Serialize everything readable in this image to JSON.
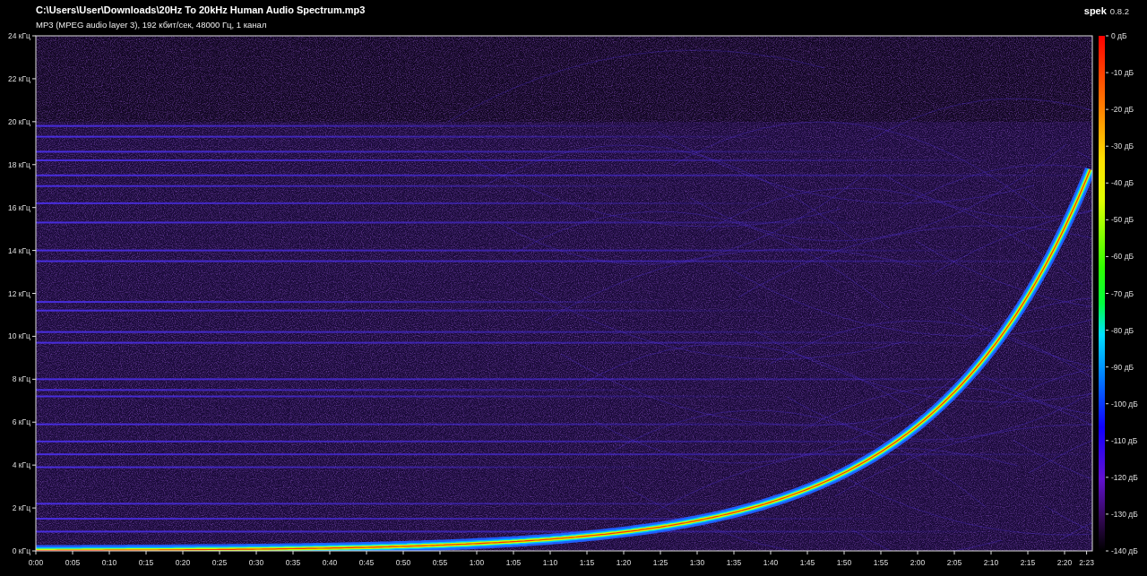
{
  "header": {
    "title": "C:\\Users\\User\\Downloads\\20Hz To 20kHz Human Audio Spectrum.mp3",
    "format_info": "MP3 (MPEG audio layer 3), 192 кбит/сек, 48000 Гц, 1 канал",
    "app_name": "spek",
    "app_version": "0.8.2"
  },
  "spectrogram": {
    "y_axis": [
      "24 кГц",
      "22 кГц",
      "20 кГц",
      "18 кГц",
      "16 кГц",
      "14 кГц",
      "12 кГц",
      "10 кГц",
      "8 кГц",
      "6 кГц",
      "4 кГц",
      "2 кГц",
      "0 кГц"
    ],
    "x_axis": {
      "ticks": [
        "0:00",
        "0:05",
        "0:10",
        "0:15",
        "0:20",
        "0:25",
        "0:30",
        "0:35",
        "0:40",
        "0:45",
        "0:50",
        "0:55",
        "1:00",
        "1:05",
        "1:10",
        "1:15",
        "1:20",
        "1:25",
        "1:30",
        "1:35",
        "1:40",
        "1:45",
        "1:50",
        "1:55",
        "2:00",
        "2:05",
        "2:10",
        "2:15",
        "2:20"
      ],
      "end_label": "2:23"
    },
    "db_scale": [
      "0 дБ",
      "-10 дБ",
      "-20 дБ",
      "-30 дБ",
      "-40 дБ",
      "-50 дБ",
      "-60 дБ",
      "-70 дБ",
      "-80 дБ",
      "-90 дБ",
      "-100 дБ",
      "-110 дБ",
      "-120 дБ",
      "-130 дБ",
      "-140 дБ"
    ]
  }
}
